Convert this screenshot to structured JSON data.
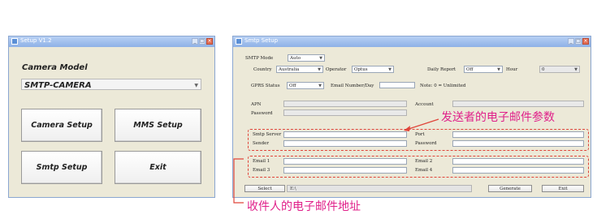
{
  "setup_window": {
    "title": "Setup  V1.2",
    "camera_model_label": "Camera Model",
    "camera_model_value": "SMTP-CAMERA",
    "buttons": {
      "camera_setup": "Camera Setup",
      "mms_setup": "MMS Setup",
      "smtp_setup": "Smtp Setup",
      "exit": "Exit"
    }
  },
  "smtp_window": {
    "title": "Smtp Setup",
    "smtp_mode": {
      "label": "SMTP Mode",
      "value": "Auto"
    },
    "country": {
      "label": "Country",
      "value": "Australia"
    },
    "operator": {
      "label": "Operator",
      "value": "Optus"
    },
    "daily_report": {
      "label": "Daily Report",
      "value": "Off"
    },
    "hour": {
      "label": "Hour",
      "value": "0"
    },
    "gprs_status": {
      "label": "GPRS Status",
      "value": "Off"
    },
    "email_number_per_day": {
      "label": "Email Number/Day",
      "value": ""
    },
    "note": "Note: 0 = Unlimited",
    "apn": {
      "label": "APN",
      "value": ""
    },
    "account": {
      "label": "Account",
      "value": ""
    },
    "password_gprs": {
      "label": "Password",
      "value": ""
    },
    "smtp_server": {
      "label": "Smtp Server",
      "value": ""
    },
    "port": {
      "label": "Port",
      "value": ""
    },
    "sender": {
      "label": "Sender",
      "value": ""
    },
    "password_sender": {
      "label": "Password",
      "value": ""
    },
    "email1": {
      "label": "Email 1",
      "value": ""
    },
    "email2": {
      "label": "Email 2",
      "value": ""
    },
    "email3": {
      "label": "Email 3",
      "value": ""
    },
    "email4": {
      "label": "Email 4",
      "value": ""
    },
    "select_button": "Select",
    "path_value": "E:\\",
    "generate_button": "Generate",
    "exit_button": "Exit"
  },
  "annotations": {
    "sender_params": "发送者的电子邮件参数",
    "recipient_address": "收件人的电子邮件地址"
  },
  "colors": {
    "annotation_text": "#e0218a",
    "dashed_box": "#e0453a",
    "titlebar": "#8eb1e6"
  }
}
